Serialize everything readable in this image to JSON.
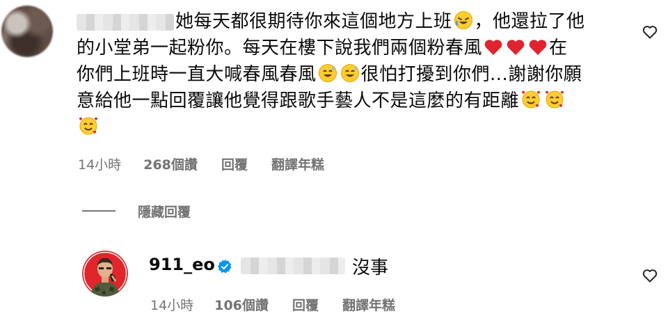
{
  "comment": {
    "text_line1": "她每天都很期待你來這個地方上班",
    "text_line1b": "，他還拉了他",
    "text_line2": "的小堂弟一起粉你。每天在樓下說我們兩個粉春風",
    "text_line2b": "在",
    "text_line3": "你們上班時一直大喊春風春風",
    "text_line3b": "很怕打擾到你們...謝謝你願",
    "text_line4": "意給他一點回覆讓他覺得跟歌手藝人不是這麼的有距離",
    "time": "14小時",
    "likes": "268個讚",
    "reply": "回覆",
    "translate": "翻譯年糕"
  },
  "thread": {
    "hide_replies": "隱藏回覆"
  },
  "reply": {
    "username": "911_eo",
    "text": "沒事",
    "time": "14小時",
    "likes": "106個讚",
    "reply": "回覆",
    "translate": "翻譯年糕"
  },
  "icons": {
    "comment_like": "heart-outline-icon",
    "reply_like": "heart-outline-icon",
    "verified": "verified-badge-icon"
  },
  "colors": {
    "meta": "#737373",
    "heart": "#e0242f",
    "verified": "#0095f6"
  }
}
